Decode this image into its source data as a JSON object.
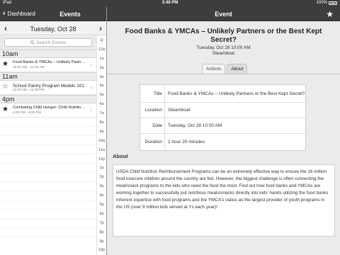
{
  "status_bar": {
    "carrier": "iPad",
    "time": "3:48 PM",
    "battery": "100%"
  },
  "left_nav": {
    "back_label": "Dashboard",
    "title": "Events"
  },
  "right_nav": {
    "title": "Event",
    "star_icon": "star-icon"
  },
  "date_bar": {
    "prev_icon": "chevron-left-icon",
    "date": "Tuesday, Oct 28",
    "next_icon": "chevron-right-icon"
  },
  "search": {
    "placeholder": "Search Events",
    "icon": "search-icon"
  },
  "index": [
    "Q",
    "12a",
    "1a",
    "2a",
    "3a",
    "4a",
    "5a",
    "6a",
    "7a",
    "8a",
    "9a",
    "10a",
    "11a",
    "12p",
    "1p",
    "2p",
    "3p",
    "4p",
    "5p",
    "6p",
    "7p",
    "8p",
    "9p",
    "10p",
    "11p"
  ],
  "sections": [
    {
      "header": "10am",
      "events": [
        {
          "title": "Food Banks & YMCAs – Unlikely Partner...",
          "time": "10:00 AM - 11:20 AM",
          "starred": true
        }
      ]
    },
    {
      "header": "11am",
      "events": [
        {
          "title": "School Pantry Program Models 101",
          "time": "11:00 AM - 12:30 PM",
          "starred": false
        }
      ]
    },
    {
      "header": "4pm",
      "events": [
        {
          "title": "Combating Child Hunger: Child Nutrition...",
          "time": "4:00 PM - 6:00 PM",
          "starred": true
        }
      ]
    }
  ],
  "event": {
    "title": "Food Banks & YMCAs – Unlikely Partners or the Best Kept Secret?",
    "datetime": "Tuesday, Oct 28 10:00 AM",
    "location": "Steamboat",
    "tabs": [
      {
        "label": "Actions",
        "active": false
      },
      {
        "label": "About",
        "active": true
      }
    ],
    "details": [
      {
        "label": "Title",
        "value": "Food Banks & YMCAs – Unlikely Partners or the Best Kept Secret?"
      },
      {
        "label": "Location",
        "value": "Steamboat"
      },
      {
        "label": "Date",
        "value": "Tuesday, Oct 28 10:00 AM"
      },
      {
        "label": "Duration",
        "value": "1 hour 20 minutes"
      }
    ],
    "about_header": "About",
    "about_text": "USDA Child Nutrition Reimbursement Programs can be an extremely effective way to ensure the 16 million food insecure children around the country are fed.  However, the biggest challenge is often connecting the meal/snack programs to the kids who need the food the most.  Find out how food banks and YMCAs are working together to successfully put nutritious meals/snacks directly into kids' hands utilizing the food banks inherent expertise with food programs and the YMCA's status as the largest provider of youth programs in the US (over 9 million kids served at Ys each year)!"
  },
  "colors": {
    "nav_bg": "#3d3d3d",
    "page_bg": "#ebebeb"
  }
}
